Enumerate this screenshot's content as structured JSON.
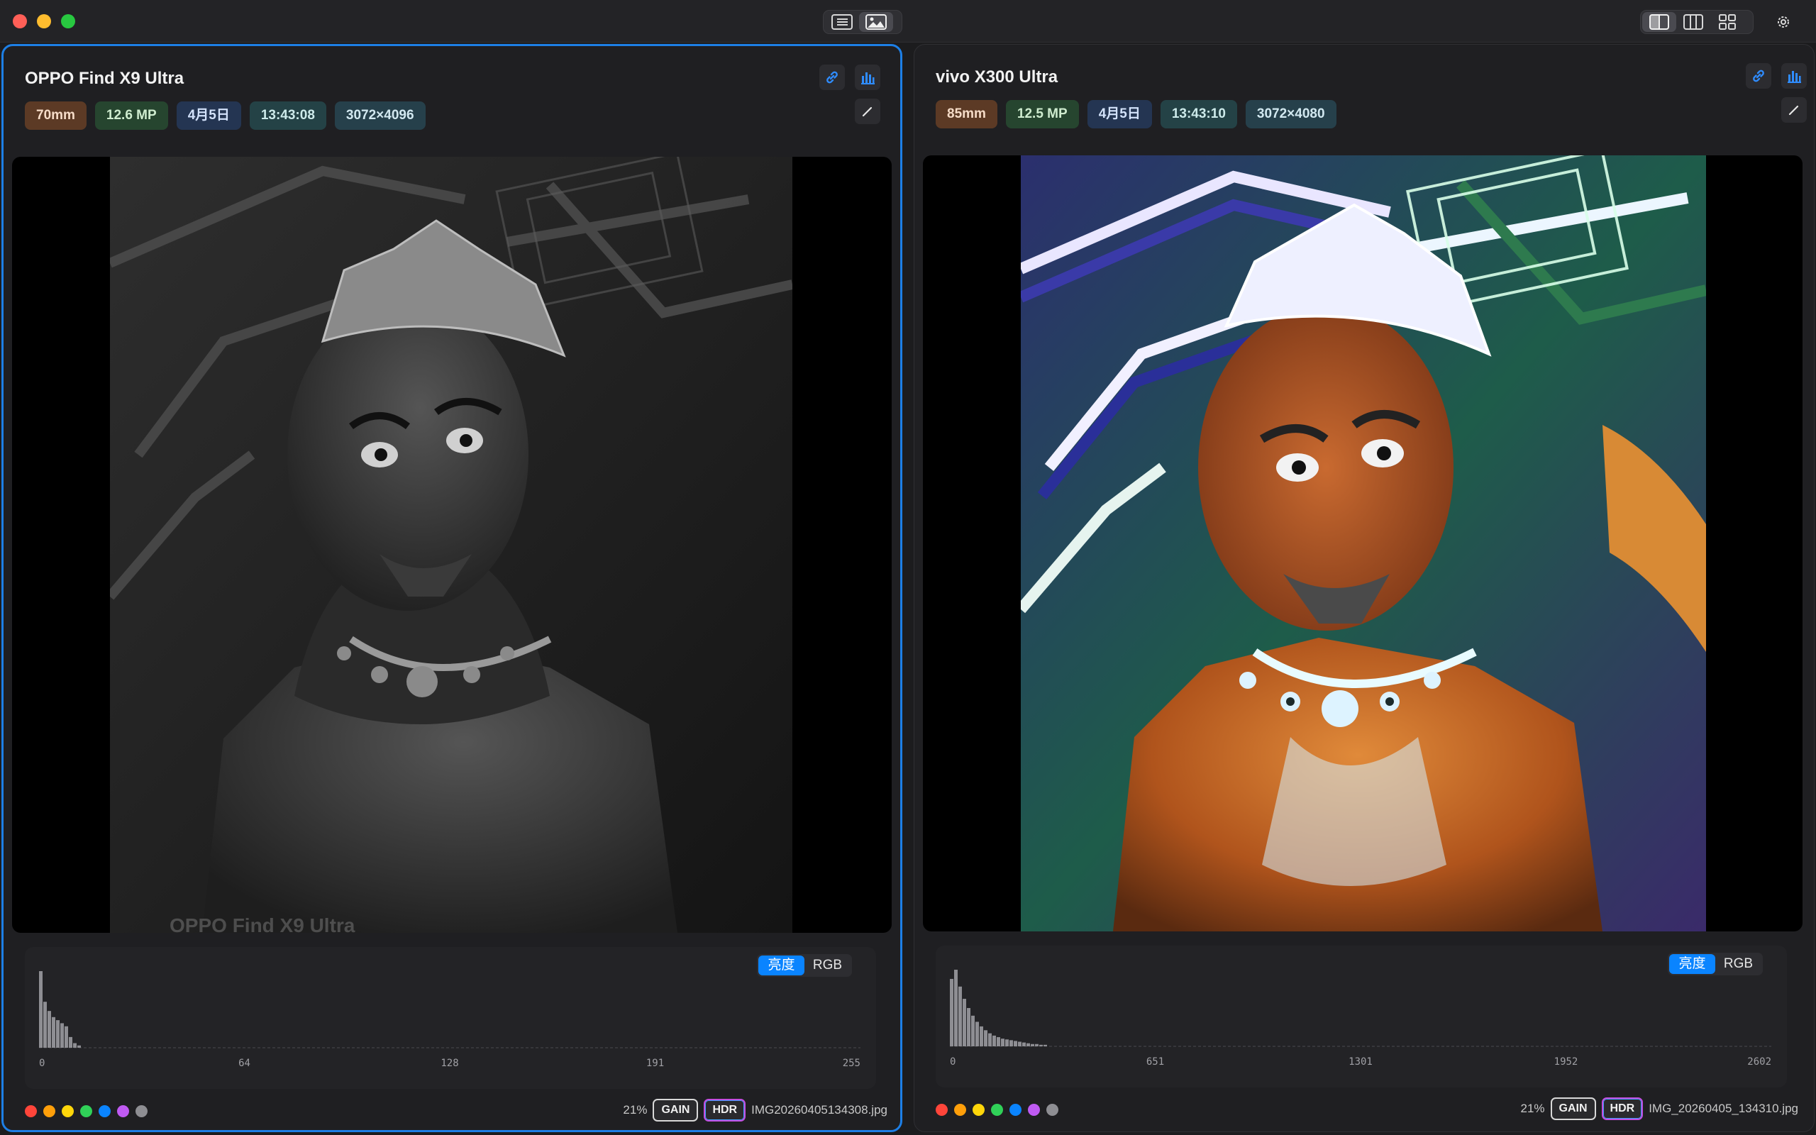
{
  "toolbar": {
    "center": [
      "list-view",
      "image-view"
    ],
    "right": [
      "layout-two",
      "layout-three",
      "layout-grid",
      "settings"
    ]
  },
  "panels": [
    {
      "device": "OPPO Find X9 Ultra",
      "chips": {
        "focal": "70mm",
        "megapixels": "12.6 MP",
        "date": "4月5日",
        "time": "13:43:08",
        "resolution": "3072×4096"
      },
      "watermark": "OPPO Find X9 Ultra",
      "histogram": {
        "mode_luma": "亮度",
        "mode_rgb": "RGB",
        "active_mode": "亮度",
        "ticks": [
          "0",
          "64",
          "128",
          "191",
          "255"
        ],
        "bins": [
          100,
          60,
          48,
          40,
          36,
          32,
          28,
          14,
          6,
          3
        ]
      },
      "footer": {
        "zoom": "21%",
        "gain": "GAIN",
        "hdr": "HDR",
        "filename": "IMG20260405134308.jpg"
      }
    },
    {
      "device": "vivo X300 Ultra",
      "chips": {
        "focal": "85mm",
        "megapixels": "12.5 MP",
        "date": "4月5日",
        "time": "13:43:10",
        "resolution": "3072×4080"
      },
      "watermark": "",
      "histogram": {
        "mode_luma": "亮度",
        "mode_rgb": "RGB",
        "active_mode": "亮度",
        "ticks": [
          "0",
          "651",
          "1301",
          "1952",
          "2602"
        ],
        "bins": [
          88,
          100,
          78,
          62,
          50,
          40,
          32,
          26,
          21,
          17,
          14,
          12,
          10,
          9,
          8,
          7,
          6,
          5,
          4,
          3,
          3,
          2,
          2
        ]
      },
      "footer": {
        "zoom": "21%",
        "gain": "GAIN",
        "hdr": "HDR",
        "filename": "IMG_20260405_134310.jpg"
      }
    }
  ],
  "label_colors": [
    "#ff453a",
    "#ff9f0a",
    "#ffd60a",
    "#30d158",
    "#0a84ff",
    "#bf5af2",
    "#8e8e93"
  ]
}
